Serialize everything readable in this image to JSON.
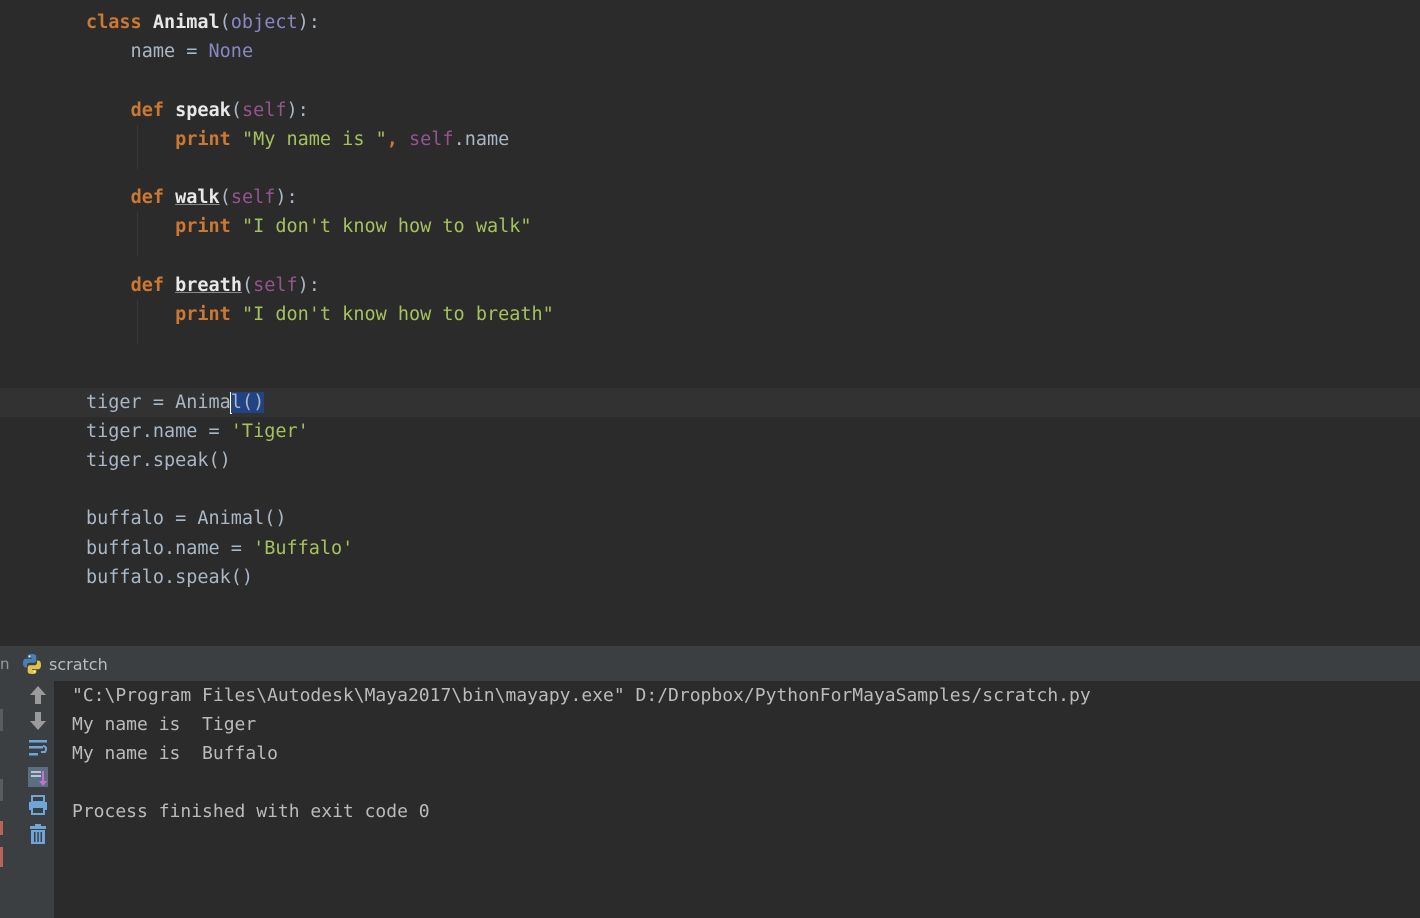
{
  "editor": {
    "lines": [
      {
        "tokens": [
          {
            "t": "class ",
            "c": "kw"
          },
          {
            "t": "Animal",
            "c": "cls"
          },
          {
            "t": "(",
            "c": "punct"
          },
          {
            "t": "object",
            "c": "builtin"
          },
          {
            "t": "):",
            "c": "punct"
          }
        ]
      },
      {
        "tokens": [
          {
            "t": "    name ",
            "c": "punct"
          },
          {
            "t": "=",
            "c": "punct"
          },
          {
            "t": " ",
            "c": "punct"
          },
          {
            "t": "None",
            "c": "builtin"
          }
        ]
      },
      {
        "tokens": []
      },
      {
        "tokens": [
          {
            "t": "    ",
            "c": "punct"
          },
          {
            "t": "def ",
            "c": "kw"
          },
          {
            "t": "speak",
            "c": "fn"
          },
          {
            "t": "(",
            "c": "punct"
          },
          {
            "t": "self",
            "c": "selfp"
          },
          {
            "t": "):",
            "c": "punct"
          }
        ]
      },
      {
        "tokens": [
          {
            "t": "        ",
            "c": "punct"
          },
          {
            "t": "print ",
            "c": "kw"
          },
          {
            "t": "\"My name is \"",
            "c": "str"
          },
          {
            "t": ", ",
            "c": "kw"
          },
          {
            "t": "self",
            "c": "selfp"
          },
          {
            "t": ".name",
            "c": "punct"
          }
        ]
      },
      {
        "tokens": []
      },
      {
        "tokens": [
          {
            "t": "    ",
            "c": "punct"
          },
          {
            "t": "def ",
            "c": "kw"
          },
          {
            "t": "walk",
            "c": "fn-u"
          },
          {
            "t": "(",
            "c": "punct"
          },
          {
            "t": "self",
            "c": "selfp"
          },
          {
            "t": "):",
            "c": "punct"
          }
        ]
      },
      {
        "tokens": [
          {
            "t": "        ",
            "c": "punct"
          },
          {
            "t": "print ",
            "c": "kw"
          },
          {
            "t": "\"I don't know how to walk\"",
            "c": "str"
          }
        ]
      },
      {
        "tokens": []
      },
      {
        "tokens": [
          {
            "t": "    ",
            "c": "punct"
          },
          {
            "t": "def ",
            "c": "kw"
          },
          {
            "t": "breath",
            "c": "fn-u"
          },
          {
            "t": "(",
            "c": "punct"
          },
          {
            "t": "self",
            "c": "selfp"
          },
          {
            "t": "):",
            "c": "punct"
          }
        ]
      },
      {
        "tokens": [
          {
            "t": "        ",
            "c": "punct"
          },
          {
            "t": "print ",
            "c": "kw"
          },
          {
            "t": "\"I don't know how to breath\"",
            "c": "str"
          }
        ]
      },
      {
        "tokens": []
      },
      {
        "tokens": []
      },
      {
        "current": true,
        "tokens": [
          {
            "t": "tiger = Anim",
            "c": "punct"
          },
          {
            "t": "a",
            "c": "punct"
          },
          {
            "caret": true
          },
          {
            "t": "l",
            "c": "punct sel"
          },
          {
            "t": "()",
            "c": "punct sel"
          }
        ]
      },
      {
        "tokens": [
          {
            "t": "tiger.name = ",
            "c": "punct"
          },
          {
            "t": "'Tiger'",
            "c": "str"
          }
        ]
      },
      {
        "tokens": [
          {
            "t": "tiger.speak()",
            "c": "punct"
          }
        ]
      },
      {
        "tokens": []
      },
      {
        "tokens": [
          {
            "t": "buffalo = Animal()",
            "c": "punct"
          }
        ]
      },
      {
        "tokens": [
          {
            "t": "buffalo.name = ",
            "c": "punct"
          },
          {
            "t": "'Buffalo'",
            "c": "str"
          }
        ]
      },
      {
        "tokens": [
          {
            "t": "buffalo.speak()",
            "c": "punct"
          }
        ]
      }
    ]
  },
  "run_panel": {
    "prefix": "n",
    "title": "scratch",
    "icon": "python-icon",
    "toolbar": [
      "up-arrow-icon",
      "down-arrow-icon",
      "soft-wrap-icon",
      "scroll-to-end-icon",
      "print-icon",
      "trash-icon"
    ],
    "output": [
      "\"C:\\Program Files\\Autodesk\\Maya2017\\bin\\mayapy.exe\" D:/Dropbox/PythonForMayaSamples/scratch.py",
      "My name is  Tiger",
      "My name is  Buffalo",
      "",
      "Process finished with exit code 0"
    ]
  }
}
